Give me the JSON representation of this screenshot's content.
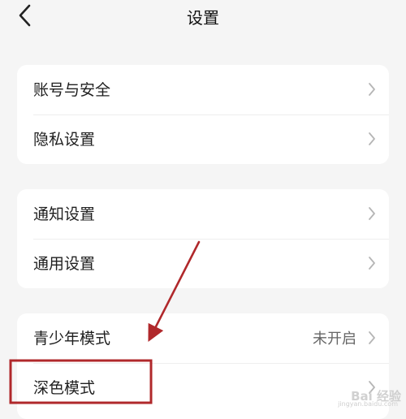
{
  "header": {
    "title": "设置",
    "back_icon": "chevron-left-icon"
  },
  "sections": [
    {
      "items": [
        {
          "label": "账号与安全"
        },
        {
          "label": "隐私设置"
        }
      ]
    },
    {
      "items": [
        {
          "label": "通知设置"
        },
        {
          "label": "通用设置"
        }
      ]
    },
    {
      "items": [
        {
          "label": "青少年模式",
          "value": "未开启"
        },
        {
          "label": "深色模式"
        }
      ]
    }
  ],
  "annotation": {
    "color": "#b0282b"
  },
  "watermark": {
    "text": "Bai 经验",
    "sub": "jingyan.baidu.com"
  }
}
